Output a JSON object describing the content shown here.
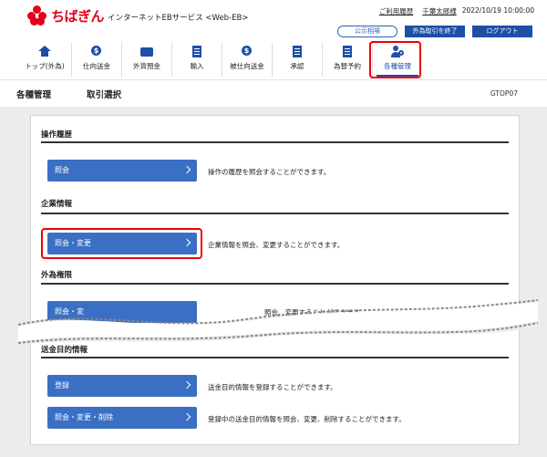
{
  "brand": {
    "name": "ちばぎん",
    "service": "インターネットEBサービス <Web-EB>"
  },
  "utility": {
    "help_link": "ご利用履歴",
    "user_name": "千葉太郎様",
    "datetime": "2022/10/19 10:00:00"
  },
  "header_buttons": {
    "market_rate": "公示相場",
    "end_fx": "外為取引を終了",
    "logout": "ログアウト"
  },
  "nav": {
    "items": [
      {
        "label": "トップ(外為)",
        "icon": "house-icon"
      },
      {
        "label": "仕向送金",
        "icon": "coin-icon"
      },
      {
        "label": "外貨預金",
        "icon": "wallet-icon"
      },
      {
        "label": "輸入",
        "icon": "document-icon"
      },
      {
        "label": "被仕向送金",
        "icon": "coin-icon"
      },
      {
        "label": "承認",
        "icon": "document-icon"
      },
      {
        "label": "為替予約",
        "icon": "document-icon"
      },
      {
        "label": "各種管理",
        "icon": "user-gear-icon"
      }
    ]
  },
  "titlebar": {
    "title": "各種管理",
    "subtitle": "取引選択",
    "screen_code": "GTOP07"
  },
  "sections": {
    "history": {
      "title": "操作履歴",
      "button": "照会",
      "desc": "操作の履歴を照会することができます。"
    },
    "company": {
      "title": "企業情報",
      "button": "照会・変更",
      "desc": "企業情報を照会、変更することができます。"
    },
    "fx_permission": {
      "title": "外為権限",
      "button": "照会・変",
      "desc": "照会、変更することができます。"
    },
    "remit_purpose": {
      "title": "送金目的情報",
      "register_button": "登録",
      "register_desc": "送金目的情報を登録することができます。",
      "edit_button": "照会・変更・削除",
      "edit_desc": "登録中の送金目的情報を照会、変更、削除することができます。"
    }
  }
}
